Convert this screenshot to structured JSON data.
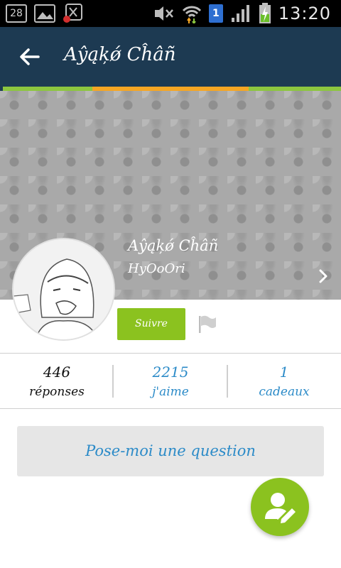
{
  "status_bar": {
    "notification_count": "28",
    "sim_number": "1",
    "time": "13:20",
    "icons": [
      "notification-count-icon",
      "gallery-icon",
      "app-notification-icon",
      "mute-icon",
      "wifi-icon",
      "sim-icon",
      "signal-icon",
      "battery-charging-icon"
    ]
  },
  "toolbar": {
    "title": "Aŷąķǿ Cĥâñ",
    "back_icon": "arrow-left-icon",
    "background": "#1d3a52"
  },
  "accent_strip": {
    "colors": [
      "#8cc63f",
      "#f6a623",
      "#8cc63f"
    ]
  },
  "profile": {
    "name": "Aŷąķǿ Cĥâñ",
    "handle": "HyOoOri",
    "follow_label": "Suivre",
    "follow_color": "#8bc21f",
    "flag_icon": "flag-icon",
    "chevron_icon": "chevron-right-icon"
  },
  "stats": [
    {
      "value": "446",
      "label": "réponses"
    },
    {
      "value": "2215",
      "label": "j'aime"
    },
    {
      "value": "1",
      "label": "cadeaux"
    }
  ],
  "ask": {
    "label": "Pose-moi une question",
    "color": "#2c8bc8"
  },
  "fab": {
    "icon": "edit-user-icon",
    "color": "#8bc21f"
  }
}
